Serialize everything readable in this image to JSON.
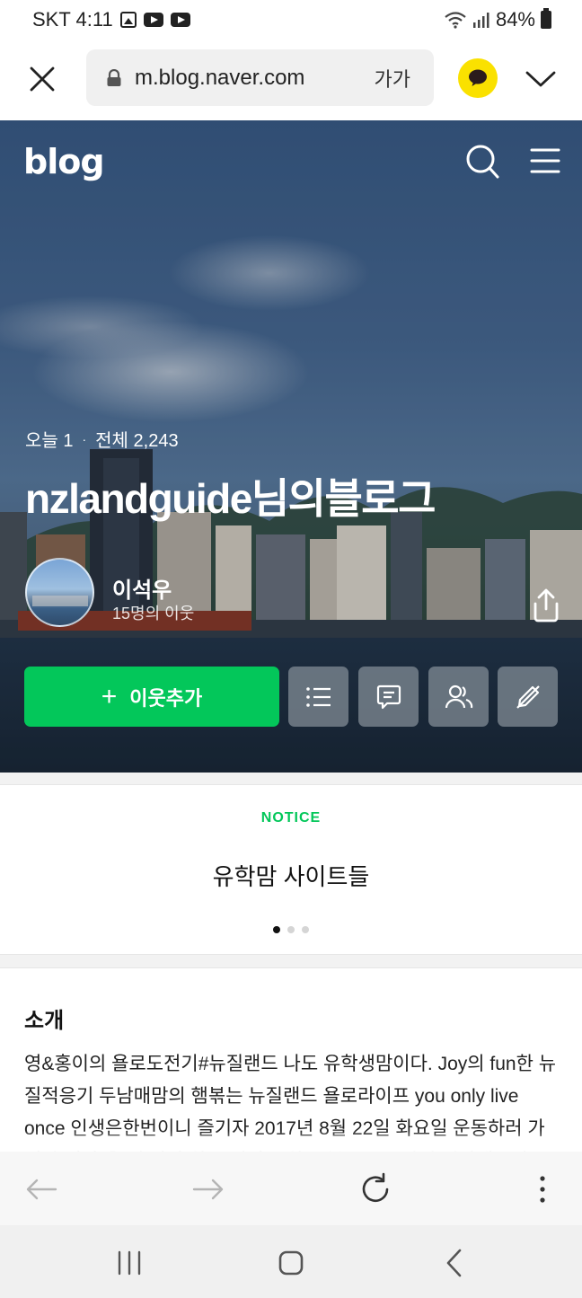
{
  "status_bar": {
    "carrier_time": "SKT 4:11",
    "battery": "84%",
    "icons": [
      "image-icon",
      "youtube-icon",
      "youtube-icon",
      "wifi-icon",
      "signal-icon",
      "battery-icon"
    ]
  },
  "browser": {
    "url": "m.blog.naver.com",
    "font_size_label": "가가",
    "icons": [
      "close-icon",
      "lock-icon",
      "kakaotalk-icon",
      "chevron-down-icon"
    ]
  },
  "hero": {
    "logo": "blog",
    "today_label": "오늘 1",
    "separator": "·",
    "total_label": "전체 2,243",
    "blog_title": "nzlandguide님의블로그",
    "owner_name": "이석우",
    "neighbor_count": "15명의 이웃",
    "add_neighbor_label": "이웃추가",
    "add_neighbor_plus": "+",
    "icons": [
      "search-icon",
      "menu-icon",
      "share-icon",
      "list-icon",
      "guestbook-icon",
      "neighbors-icon",
      "no-pencil-icon"
    ],
    "accent_color": "#03c75a"
  },
  "notice": {
    "label": "NOTICE",
    "title": "유학맘 사이트들",
    "page_count": 3,
    "active_page": 1
  },
  "intro": {
    "heading": "소개",
    "text": "영&홍이의 욜로도전기#뉴질랜드 나도 유학생맘이다. Joy의 fun한 뉴질적응기 두남매맘의 햄볶는 뉴질랜드 욜로라이프 you only live once 인생은한번이니 즐기자 2017년 8월 22일 화요일 운동하러 가려다 비가 올 것 같아 하루 쉬기로 하고 블로그를 다시 시작해보려고 합니다."
  },
  "bottom_toolbar": {
    "icons": [
      "back-arrow-icon",
      "forward-arrow-icon",
      "refresh-icon",
      "more-vertical-icon"
    ]
  },
  "system_nav": {
    "icons": [
      "recent-apps-icon",
      "home-icon",
      "back-icon"
    ]
  }
}
